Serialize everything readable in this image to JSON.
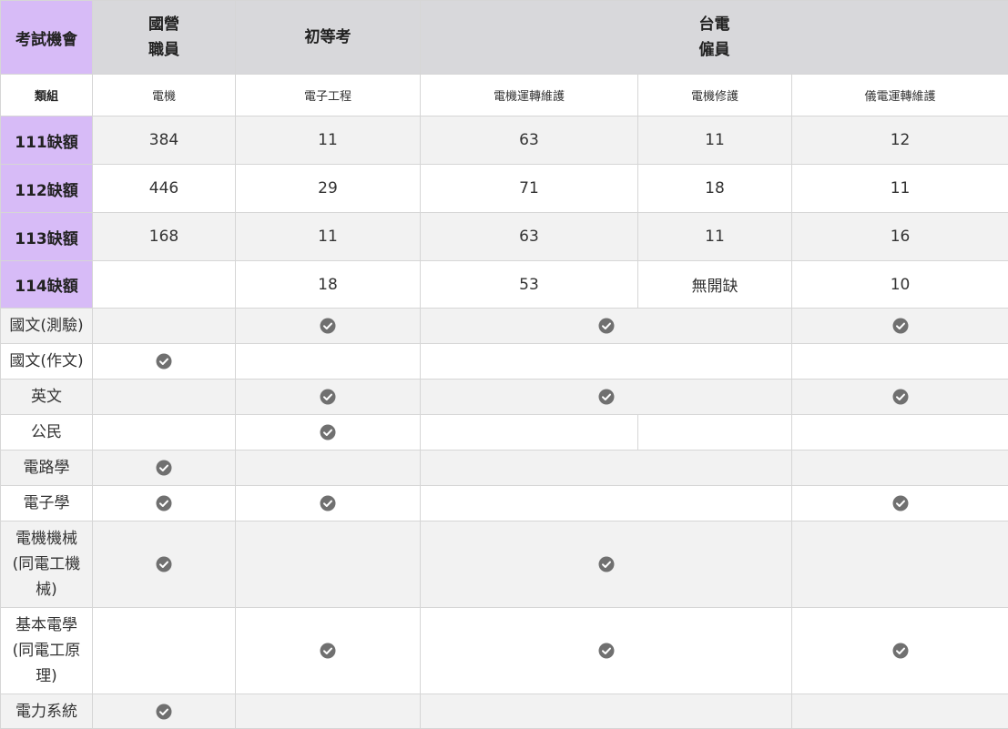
{
  "header": {
    "corner": "考試機會",
    "col1": "國營\n職員",
    "col2": "初等考",
    "col3": "台電\n僱員"
  },
  "category": {
    "label": "類組",
    "values": [
      "電機",
      "電子工程",
      "電機運轉維護",
      "電機修護",
      "儀電運轉維護"
    ]
  },
  "vacancies": [
    {
      "label": "111缺額",
      "values": [
        "384",
        "11",
        "63",
        "11",
        "12"
      ]
    },
    {
      "label": "112缺額",
      "values": [
        "446",
        "29",
        "71",
        "18",
        "11"
      ]
    },
    {
      "label": "113缺額",
      "values": [
        "168",
        "11",
        "63",
        "11",
        "16"
      ]
    },
    {
      "label": "114缺額",
      "values": [
        "",
        "18",
        "53",
        "無開缺",
        "10"
      ]
    }
  ],
  "subjects": {
    "chinese_test": "國文(測驗)",
    "chinese_essay": "國文(作文)",
    "english": "英文",
    "civics": "公民",
    "circuits": "電路學",
    "electronics": "電子學",
    "machinery": "電機機械\n(同電工機\n械)",
    "basic_ee": "基本電學\n(同電工原\n理)",
    "power_systems": "電力系統"
  },
  "icons": {
    "check": "check-circle-icon"
  },
  "colors": {
    "row_header_bg": "#d7bbf7",
    "column_header_bg": "#d8d8db",
    "stripe_bg": "#f2f2f2",
    "check_icon": "#707070"
  }
}
